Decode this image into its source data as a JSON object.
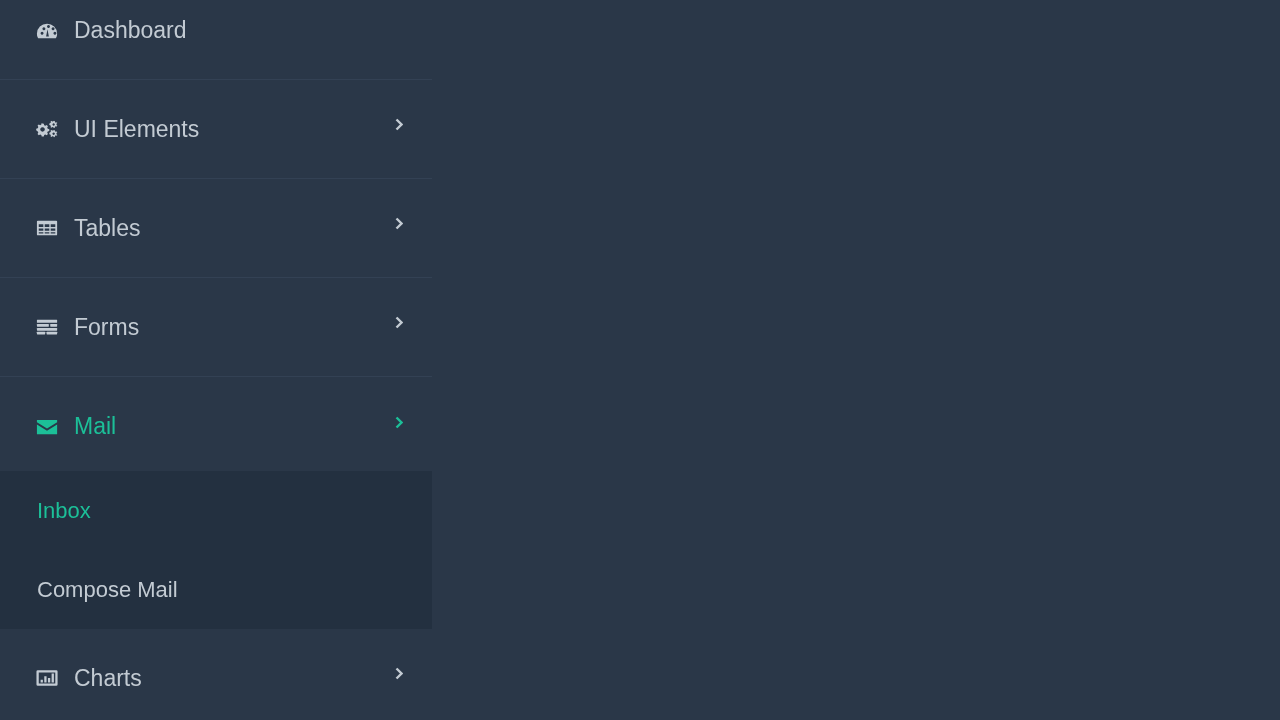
{
  "sidebar": {
    "items": [
      {
        "label": "Dashboard",
        "kind": "link",
        "selected": false,
        "expanded": false
      },
      {
        "label": "UI Elements",
        "kind": "submenu",
        "selected": false,
        "expanded": false
      },
      {
        "label": "Tables",
        "kind": "submenu",
        "selected": false,
        "expanded": false
      },
      {
        "label": "Forms",
        "kind": "submenu",
        "selected": false,
        "expanded": false
      },
      {
        "label": "Mail",
        "kind": "submenu",
        "selected": true,
        "expanded": true,
        "children": [
          {
            "label": "Inbox",
            "selected": true
          },
          {
            "label": "Compose Mail",
            "selected": false
          }
        ]
      },
      {
        "label": "Charts",
        "kind": "submenu",
        "selected": false,
        "expanded": false
      }
    ]
  }
}
